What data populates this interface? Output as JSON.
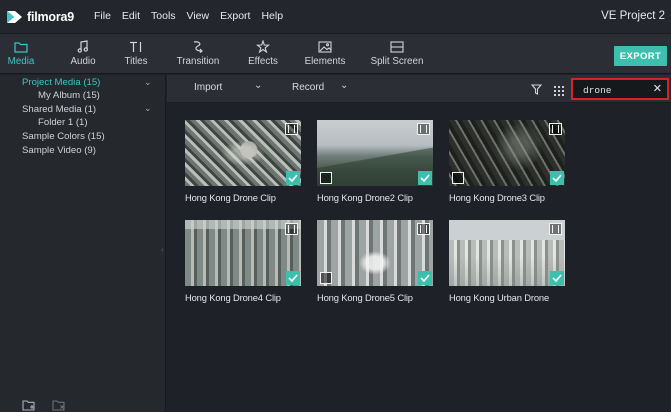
{
  "app": {
    "logo_text": "filmora9",
    "project_title": "VE Project 2"
  },
  "menu": [
    "File",
    "Edit",
    "Tools",
    "View",
    "Export",
    "Help"
  ],
  "toolbar": {
    "tools": [
      {
        "label": "Media",
        "icon": "folder-icon",
        "active": true
      },
      {
        "label": "Audio",
        "icon": "music-note-icon",
        "active": false
      },
      {
        "label": "Titles",
        "icon": "text-cursor-icon",
        "active": false
      },
      {
        "label": "Transition",
        "icon": "transition-icon",
        "active": false
      },
      {
        "label": "Effects",
        "icon": "sparkle-icon",
        "active": false
      },
      {
        "label": "Elements",
        "icon": "image-icon",
        "active": false
      },
      {
        "label": "Split Screen",
        "icon": "split-screen-icon",
        "active": false
      }
    ],
    "export_label": "EXPORT"
  },
  "sidebar": {
    "items": [
      {
        "label": "Project Media (15)",
        "selected": true,
        "expandable": true
      },
      {
        "label": "My Album (15)",
        "selected": false,
        "expandable": false
      },
      {
        "label": "Shared Media (1)",
        "selected": false,
        "expandable": true
      },
      {
        "label": "Folder 1 (1)",
        "selected": false,
        "expandable": false
      },
      {
        "label": "Sample Colors (15)",
        "selected": false,
        "expandable": false
      },
      {
        "label": "Sample Video (9)",
        "selected": false,
        "expandable": false
      }
    ],
    "bottom_icons": [
      "new-folder-icon",
      "delete-folder-icon"
    ]
  },
  "media_header": {
    "import_label": "Import",
    "record_label": "Record",
    "search": {
      "value": "drone",
      "clear_icon": "close-icon"
    }
  },
  "clips": [
    {
      "title": "Hong Kong Drone Clip",
      "proxy": false
    },
    {
      "title": "Hong Kong Drone2 Clip",
      "proxy": true
    },
    {
      "title": "Hong Kong Drone3 Clip",
      "proxy": true
    },
    {
      "title": "Hong Kong Drone4 Clip",
      "proxy": false
    },
    {
      "title": "Hong Kong Drone5 Clip",
      "proxy": true
    },
    {
      "title": "Hong Kong Urban Drone",
      "proxy": false
    }
  ],
  "colors": {
    "accent": "#3ac7c5",
    "export_button": "#3dbfad",
    "search_highlight": "#d6232b",
    "background": "#1e2228"
  }
}
